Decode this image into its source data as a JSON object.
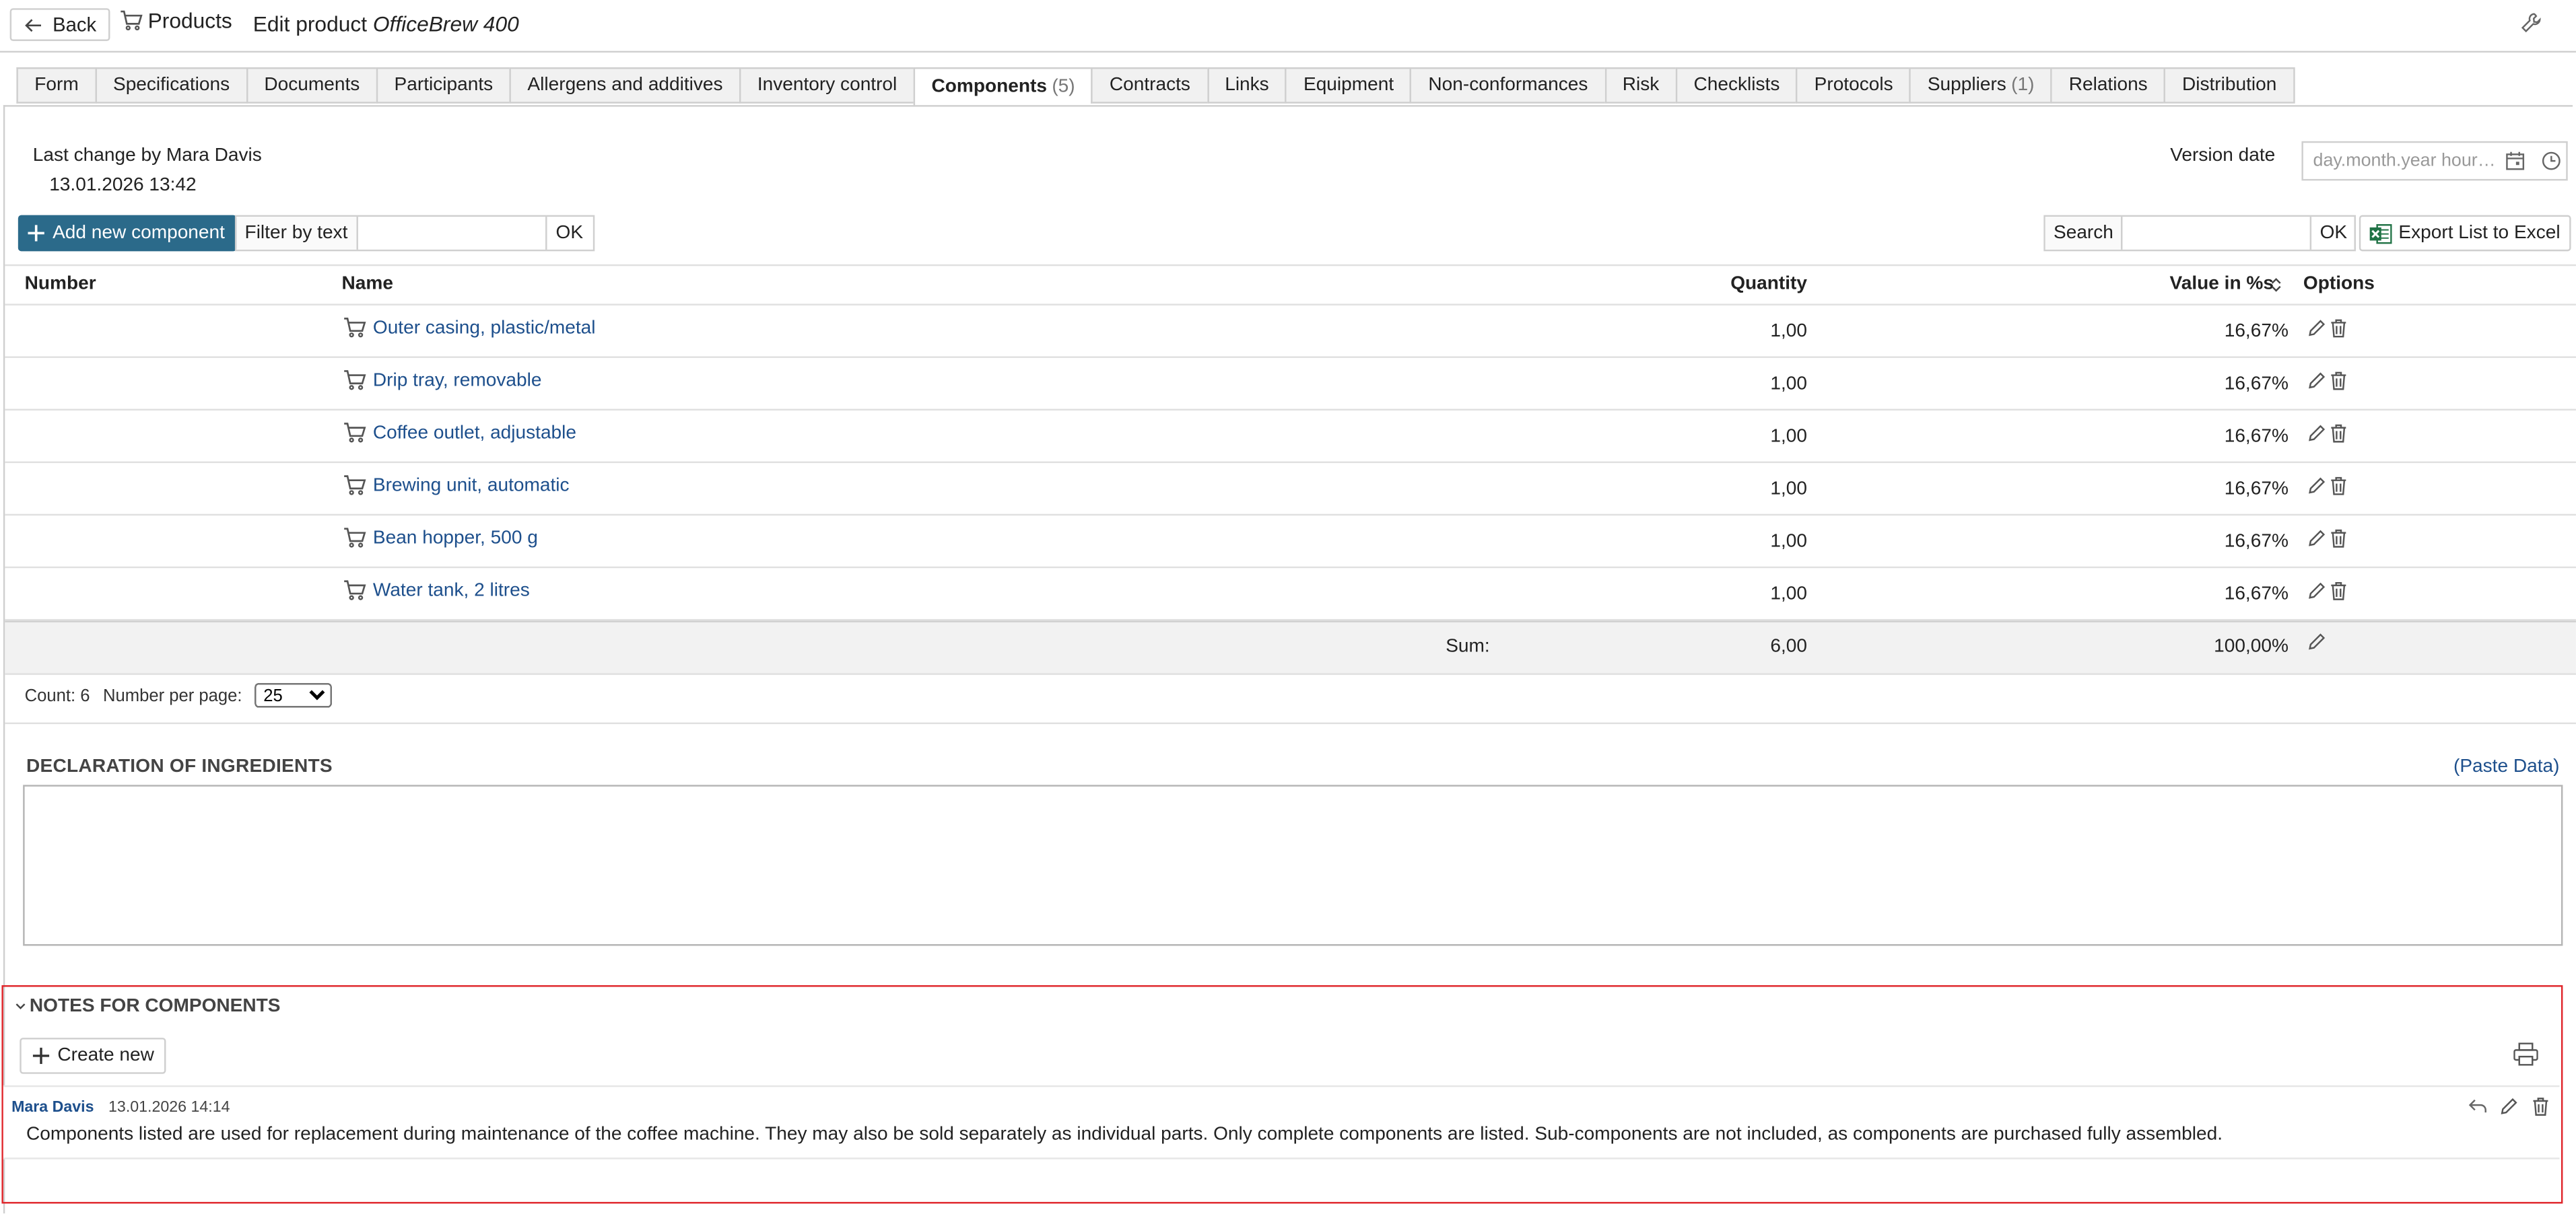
{
  "header": {
    "back_label": "Back",
    "breadcrumb_label": "Products",
    "title_prefix": "Edit product ",
    "title_product": "OfficeBrew 400"
  },
  "tabs": [
    {
      "label": "Form",
      "count": ""
    },
    {
      "label": "Specifications",
      "count": ""
    },
    {
      "label": "Documents",
      "count": ""
    },
    {
      "label": "Participants",
      "count": ""
    },
    {
      "label": "Allergens and additives",
      "count": ""
    },
    {
      "label": "Inventory control",
      "count": ""
    },
    {
      "label": "Components",
      "count": "(5)",
      "active": true
    },
    {
      "label": "Contracts",
      "count": ""
    },
    {
      "label": "Links",
      "count": ""
    },
    {
      "label": "Equipment",
      "count": ""
    },
    {
      "label": "Non-conformances",
      "count": ""
    },
    {
      "label": "Risk",
      "count": ""
    },
    {
      "label": "Checklists",
      "count": ""
    },
    {
      "label": "Protocols",
      "count": ""
    },
    {
      "label": "Suppliers",
      "count": "(1)"
    },
    {
      "label": "Relations",
      "count": ""
    },
    {
      "label": "Distribution",
      "count": ""
    }
  ],
  "last_change": {
    "label": "Last change by Mara Davis",
    "timestamp": "13.01.2026 13:42"
  },
  "version_date": {
    "label": "Version date",
    "placeholder": "day.month.year hour:minute"
  },
  "toolbar": {
    "add_label": "Add new component",
    "filter_label": "Filter by text",
    "filter_value": "",
    "filter_ok": "OK",
    "search_label": "Search",
    "search_value": "",
    "search_ok": "OK",
    "export_label": "Export List to Excel"
  },
  "table": {
    "columns": {
      "number": "Number",
      "name": "Name",
      "quantity": "Quantity",
      "value": "Value in %s",
      "options": "Options"
    },
    "rows": [
      {
        "number": "",
        "name": "Outer casing, plastic/metal",
        "quantity": "1,00",
        "value": "16,67%"
      },
      {
        "number": "",
        "name": "Drip tray, removable",
        "quantity": "1,00",
        "value": "16,67%"
      },
      {
        "number": "",
        "name": "Coffee outlet, adjustable",
        "quantity": "1,00",
        "value": "16,67%"
      },
      {
        "number": "",
        "name": "Brewing unit, automatic",
        "quantity": "1,00",
        "value": "16,67%"
      },
      {
        "number": "",
        "name": "Bean hopper, 500 g",
        "quantity": "1,00",
        "value": "16,67%"
      },
      {
        "number": "",
        "name": "Water tank, 2 litres",
        "quantity": "1,00",
        "value": "16,67%"
      }
    ],
    "sum": {
      "label": "Sum:",
      "quantity": "6,00",
      "value": "100,00%"
    }
  },
  "pager": {
    "count_label": "Count: 6",
    "per_page_label": "Number per page:",
    "per_page_value": "25"
  },
  "declaration": {
    "title": "DECLARATION OF INGREDIENTS",
    "paste_label": "(Paste Data)",
    "text": ""
  },
  "notes": {
    "title": "NOTES FOR COMPONENTS",
    "create_label": "Create new",
    "items": [
      {
        "author": "Mara Davis",
        "date": "13.01.2026 14:14",
        "text": "Components listed are used for replacement during maintenance of the coffee machine. They may also be sold separately as individual parts. Only complete components are listed. Sub-components are not included, as components are purchased fully assembled."
      }
    ]
  },
  "colors": {
    "primary_button": "#2b6a8a",
    "link": "#1d4f8c",
    "highlight_border": "#e0262b"
  }
}
